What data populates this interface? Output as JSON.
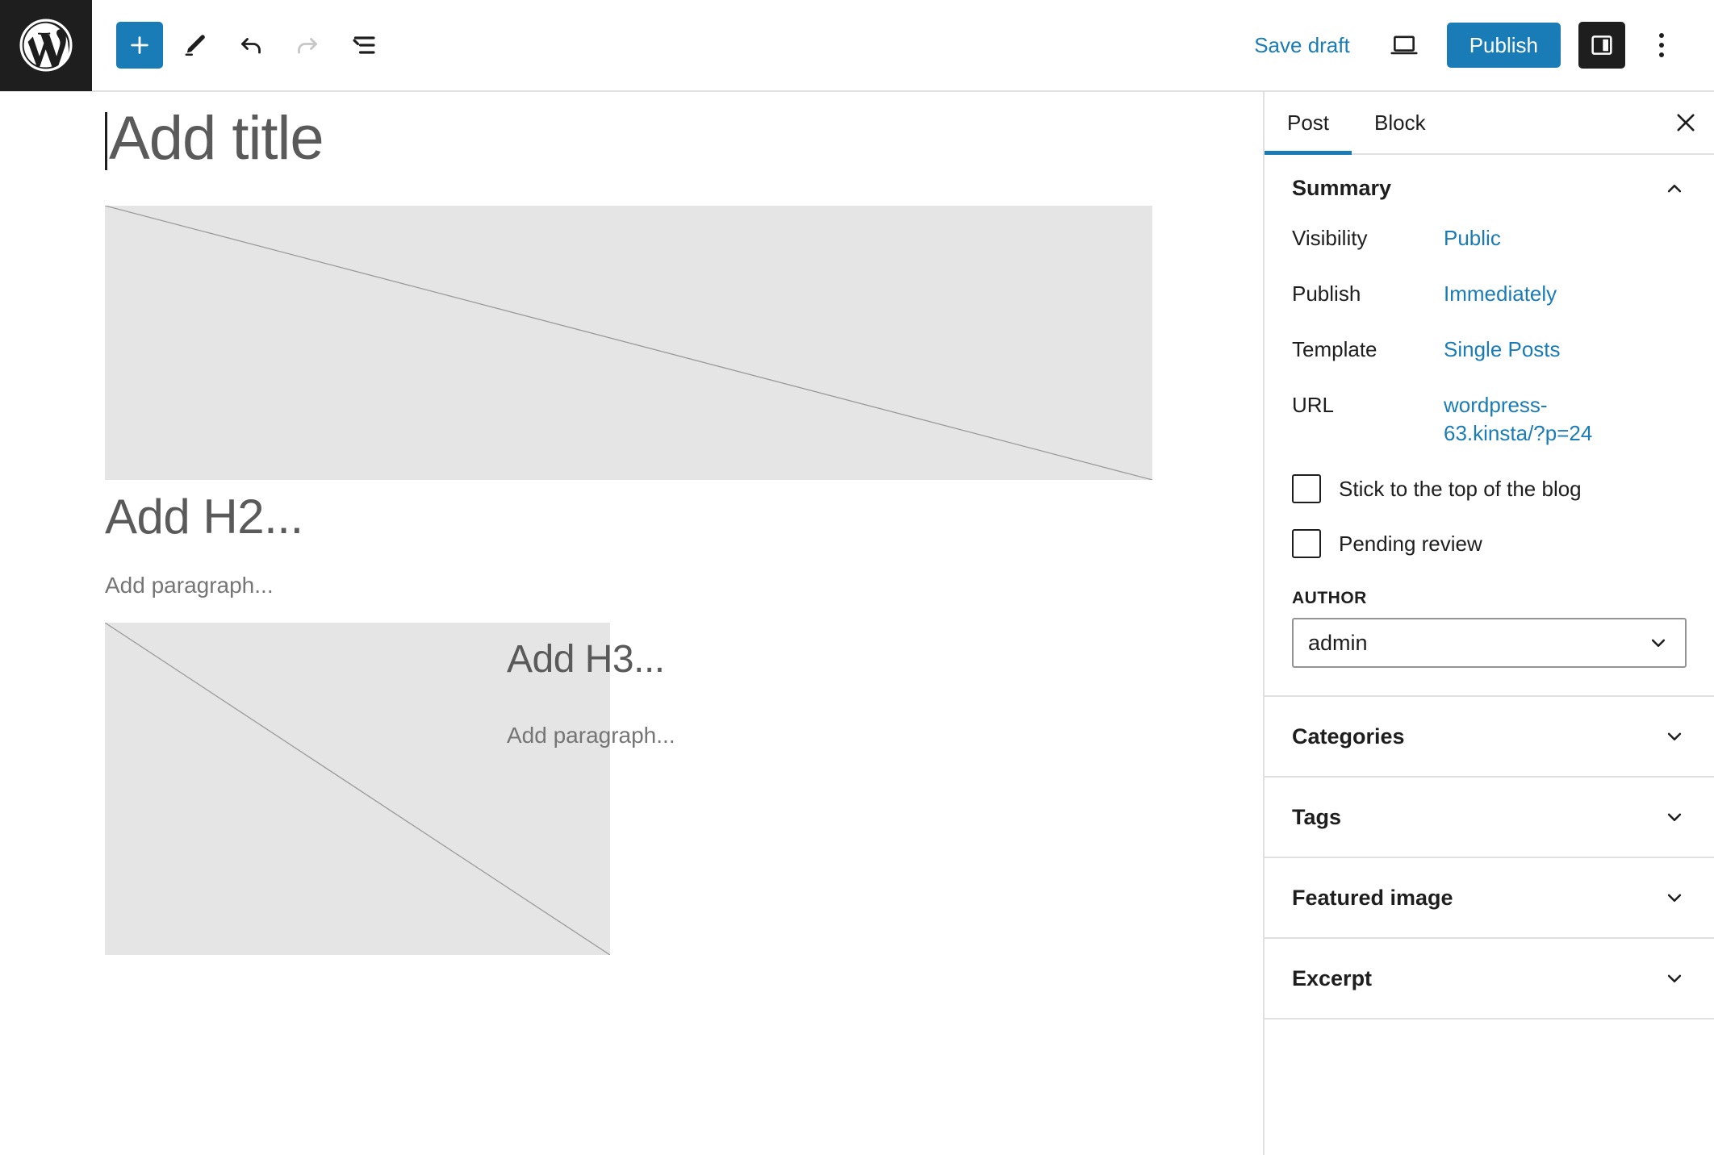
{
  "toolbar": {
    "logo_icon": "wordpress-logo-icon",
    "add_block_label": "+",
    "add_block_icon": "plus-icon",
    "tools_icon": "pencil-icon",
    "undo_icon": "undo-arrow-icon",
    "redo_icon": "redo-arrow-icon",
    "list_view_icon": "document-outline-icon",
    "save_draft_label": "Save draft",
    "preview_icon": "desktop-preview-icon",
    "publish_label": "Publish",
    "sidebar_toggle_icon": "settings-panel-icon",
    "options_icon": "kebab-menu-icon",
    "accent_color": "#1a7cb7",
    "dark_color": "#1e1e1e"
  },
  "editor": {
    "title_placeholder": "Add title",
    "blocks": [
      {
        "type": "image",
        "placeholder_label": "image-placeholder"
      },
      {
        "type": "heading2",
        "placeholder_label": "Add H2..."
      },
      {
        "type": "paragraph",
        "placeholder_label": "Add paragraph..."
      },
      {
        "type": "image",
        "placeholder_label": "image-placeholder"
      },
      {
        "type": "heading3",
        "placeholder_label": "Add H3..."
      },
      {
        "type": "paragraph",
        "placeholder_label": "Add paragraph..."
      }
    ],
    "h2_placeholder": "Add H2...",
    "h3_placeholder": "Add H3...",
    "paragraph_placeholder_1": "Add paragraph...",
    "paragraph_placeholder_2": "Add paragraph..."
  },
  "sidebar": {
    "tabs": [
      {
        "label": "Post",
        "active": true
      },
      {
        "label": "Block",
        "active": false
      }
    ],
    "close_icon": "close-icon",
    "summary": {
      "title": "Summary",
      "collapse_icon": "chevron-up-icon",
      "rows": [
        {
          "label": "Visibility",
          "value": "Public"
        },
        {
          "label": "Publish",
          "value": "Immediately"
        },
        {
          "label": "Template",
          "value": "Single Posts"
        },
        {
          "label": "URL",
          "value": "wordpress-63.kinsta/?p=24"
        }
      ],
      "checkboxes": [
        {
          "label": "Stick to the top of the blog",
          "checked": false
        },
        {
          "label": "Pending review",
          "checked": false
        }
      ],
      "author_label": "AUTHOR",
      "author_value": "admin",
      "author_chevron_icon": "chevron-down-icon"
    },
    "panels": [
      {
        "label": "Categories",
        "icon": "chevron-down-icon"
      },
      {
        "label": "Tags",
        "icon": "chevron-down-icon"
      },
      {
        "label": "Featured image",
        "icon": "chevron-down-icon"
      },
      {
        "label": "Excerpt",
        "icon": "chevron-down-icon"
      }
    ]
  }
}
